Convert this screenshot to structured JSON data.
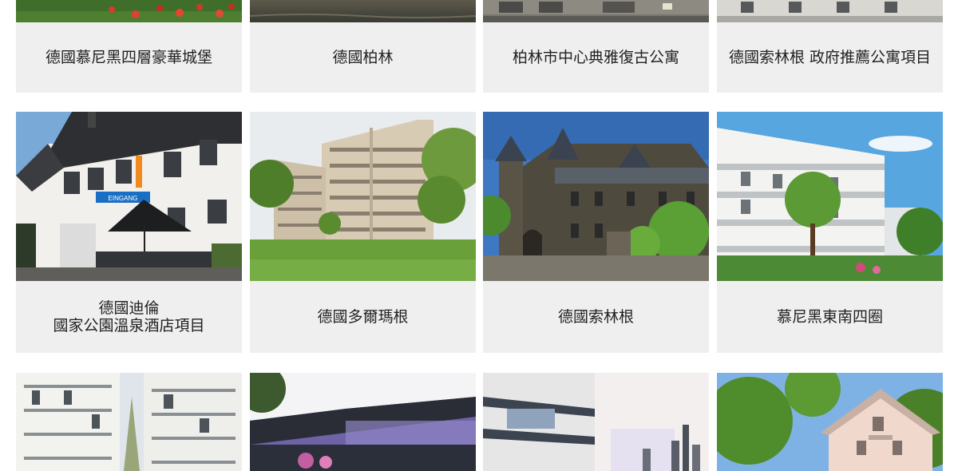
{
  "properties": [
    {
      "title": [
        "德國慕尼黑四層豪華城堡"
      ]
    },
    {
      "title": [
        "德國柏林"
      ]
    },
    {
      "title": [
        "柏林市中心典雅復古公寓"
      ]
    },
    {
      "title": [
        "德國索林根 政府推薦公寓項目"
      ]
    },
    {
      "title": [
        "德國迪倫",
        "國家公園溫泉酒店項目"
      ]
    },
    {
      "title": [
        "德國多爾瑪根"
      ]
    },
    {
      "title": [
        "德國索林根"
      ]
    },
    {
      "title": [
        "慕尼黑東南四圈"
      ]
    }
  ],
  "images": {
    "hotel_sign": "EINGANG"
  }
}
